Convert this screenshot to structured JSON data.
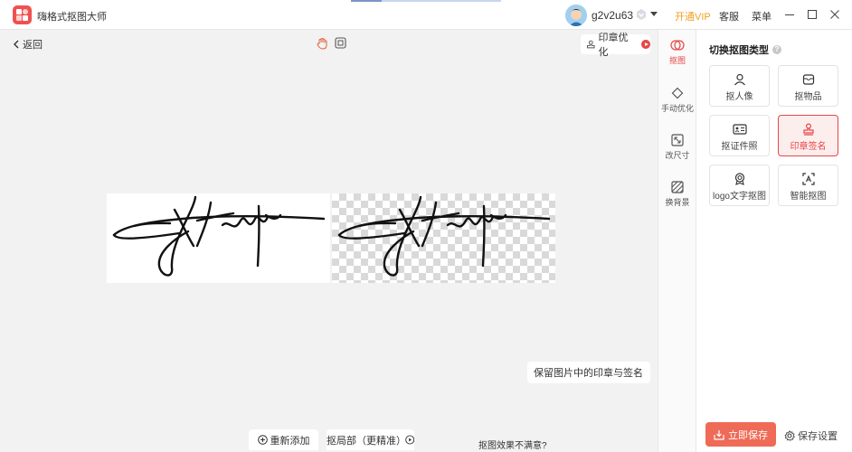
{
  "titlebar": {
    "app_title": "嗨格式抠图大师",
    "username": "g2v2u63",
    "open_vip": "开通VIP",
    "service": "客服",
    "menu": "菜单",
    "icons": [
      "app-logo",
      "avatar",
      "vip-badge-icon",
      "dropdown-arrow-icon",
      "minimize-icon",
      "maximize-icon",
      "close-icon"
    ]
  },
  "canvas": {
    "back": "返回",
    "seal_optimize": "印章优化",
    "keep_option": "保留图片中的印章与签名",
    "readd": "重新添加",
    "local_refine": "抠局部（更精准）",
    "unsatisfied": "抠图效果不满意?"
  },
  "tools": [
    {
      "label": "抠图",
      "icon": "cutout-icon",
      "active": true
    },
    {
      "label": "手动优化",
      "icon": "eraser-icon",
      "active": false
    },
    {
      "label": "改尺寸",
      "icon": "resize-icon",
      "active": false
    },
    {
      "label": "换背景",
      "icon": "background-icon",
      "active": false
    }
  ],
  "panel": {
    "title": "切换抠图类型",
    "types": [
      {
        "label": "抠人像",
        "icon": "person-icon",
        "selected": false
      },
      {
        "label": "抠物品",
        "icon": "bag-icon",
        "selected": false
      },
      {
        "label": "抠证件照",
        "icon": "id-card-icon",
        "selected": false
      },
      {
        "label": "印章签名",
        "icon": "stamp-icon",
        "selected": true
      },
      {
        "label": "logo文字抠图",
        "icon": "logo-icon",
        "selected": false
      },
      {
        "label": "智能抠图",
        "icon": "smart-scan-icon",
        "selected": false
      }
    ],
    "save_now": "立即保存",
    "save_settings": "保存设置"
  },
  "colors": {
    "accent": "#e84545",
    "vip": "#f0a020",
    "save_button": "#ef6a57"
  }
}
